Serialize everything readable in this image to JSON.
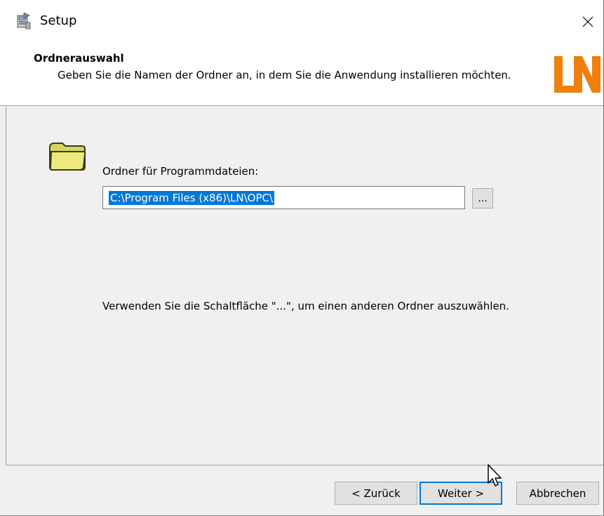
{
  "window": {
    "title": "Setup",
    "close_symbol": "✕",
    "app_icon": "setup-installer-icon"
  },
  "banner": {
    "title": "Ordnerauswahl",
    "subtitle": "Geben Sie die Namen der Ordner an, in dem Sie die Anwendung installieren möchten.",
    "logo_text": "LN",
    "logo_color": "#f07f0c"
  },
  "content": {
    "folder_icon": "folder-icon",
    "field_label": "Ordner für Programmdateien:",
    "path_value": "C:\\Program Files (x86)\\LN\\OPC\\",
    "browse_label": "...",
    "hint": "Verwenden Sie die Schaltfläche \"...\", um einen anderen Ordner auszuwählen."
  },
  "buttons": {
    "back": "< Zurück",
    "next": "Weiter >",
    "cancel": "Abbrechen"
  },
  "colors": {
    "selection": "#0078d7",
    "dialog_bg": "#f0f0f0",
    "folder_fill": "#e8e46a"
  }
}
